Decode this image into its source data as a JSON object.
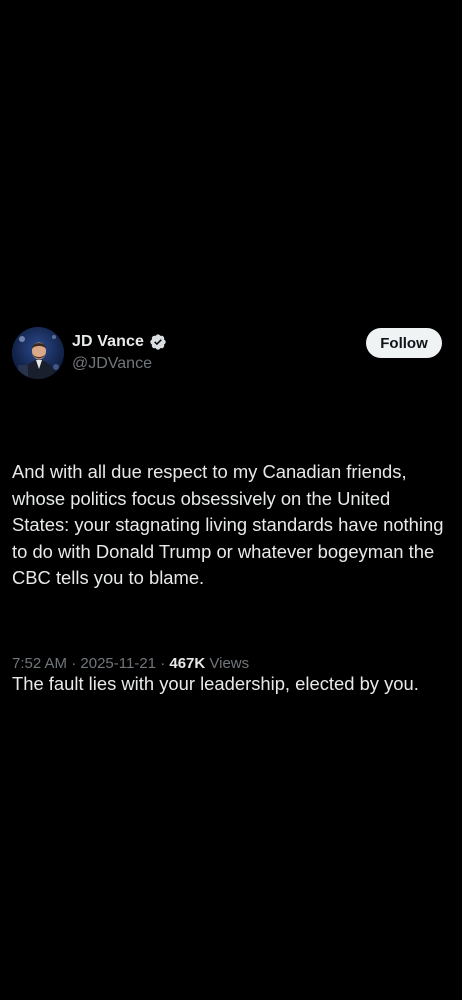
{
  "tweet": {
    "author": {
      "display_name": "JD Vance",
      "handle": "@JDVance",
      "verified": true,
      "avatar_icon": "profile-photo"
    },
    "follow_label": "Follow",
    "text": {
      "paragraph_1": "And with all due respect to my Canadian friends, whose politics focus obsessively on the United States: your stagnating living standards have nothing to do with Donald Trump or whatever bogeyman the CBC tells you to blame.",
      "paragraph_2": "The fault lies with your leadership, elected by you."
    },
    "meta": {
      "time": "7:52 AM",
      "date": "2025-11-21",
      "views_count": "467K",
      "views_label": "Views",
      "separator": "·"
    }
  },
  "colors": {
    "background": "#000000",
    "primary_text": "#e7e9ea",
    "secondary_text": "#71767b",
    "verified_badge": "#d9dde1",
    "follow_button_bg": "#eff3f4",
    "follow_button_text": "#0f1419"
  }
}
